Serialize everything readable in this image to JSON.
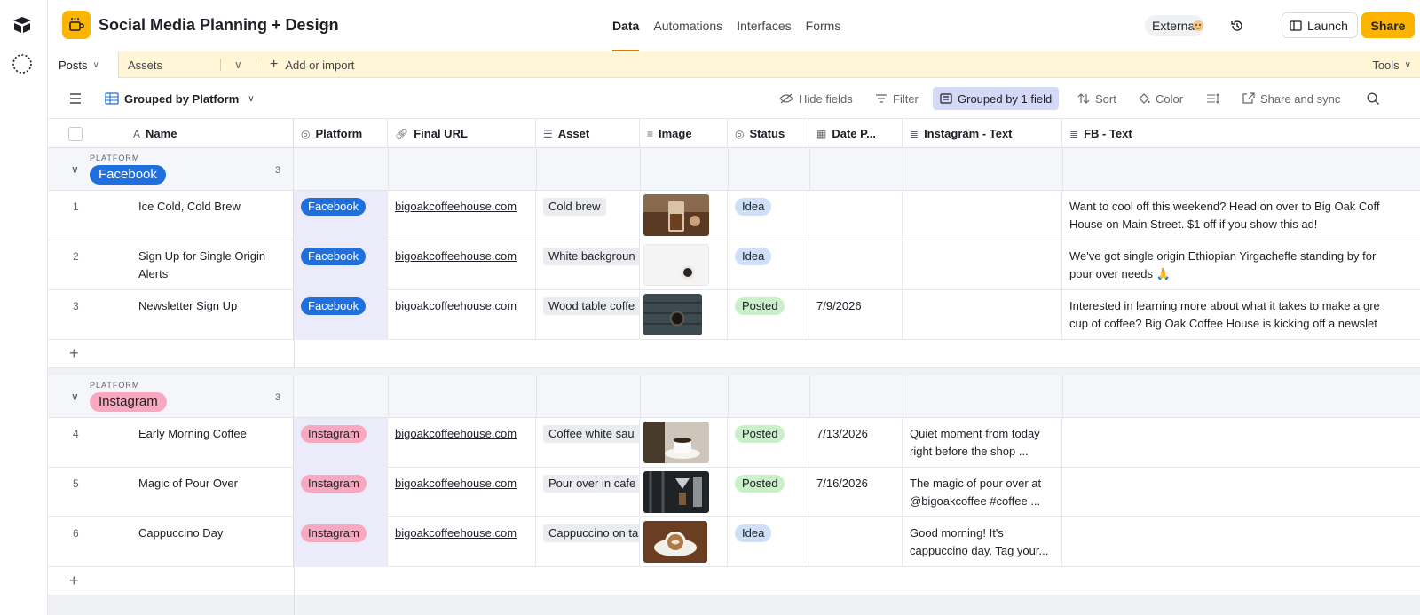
{
  "app": {
    "title": "Social Media Planning + Design",
    "nav": [
      "Data",
      "Automations",
      "Interfaces",
      "Forms"
    ],
    "active_nav": "Data",
    "external_label": "External",
    "launch_label": "Launch",
    "share_label": "Share",
    "accent_color": "#fcb400"
  },
  "tables": {
    "active": "Posts",
    "other": "Assets",
    "add_label": "Add or import",
    "tools_label": "Tools"
  },
  "view": {
    "name": "Grouped by Platform",
    "hide_fields": "Hide fields",
    "filter": "Filter",
    "grouped": "Grouped by 1 field",
    "sort": "Sort",
    "color": "Color",
    "share_sync": "Share and sync"
  },
  "columns": [
    "Name",
    "Platform",
    "Final URL",
    "Asset",
    "Image",
    "Status",
    "Date P...",
    "Instagram - Text",
    "FB - Text"
  ],
  "groups": [
    {
      "label": "PLATFORM",
      "value": "Facebook",
      "count": "3",
      "records": [
        {
          "num": "1",
          "name": "Ice Cold, Cold Brew",
          "platform": "Facebook",
          "url": "bigoakcoffeehouse.com",
          "asset": "Cold brew",
          "status": "Idea",
          "date": "",
          "ig_text": "",
          "fb_text_1": "Want to cool off this weekend? Head on over to Big Oak Coff",
          "fb_text_2": "House on Main Street. $1 off if you show this ad!"
        },
        {
          "num": "2",
          "name": "Sign Up for Single Origin Alerts",
          "platform": "Facebook",
          "url": "bigoakcoffeehouse.com",
          "asset": "White backgroun",
          "status": "Idea",
          "date": "",
          "ig_text": "",
          "fb_text_1": "We've got single origin Ethiopian Yirgacheffe standing by for",
          "fb_text_2": "pour over needs 🙏"
        },
        {
          "num": "3",
          "name": "Newsletter Sign Up",
          "platform": "Facebook",
          "url": "bigoakcoffeehouse.com",
          "asset": "Wood table coffe",
          "status": "Posted",
          "date": "7/9/2026",
          "ig_text": "",
          "fb_text_1": "Interested in learning more about what it takes to make a gre",
          "fb_text_2": "cup of coffee? Big Oak Coffee House is kicking off a newslet"
        }
      ]
    },
    {
      "label": "PLATFORM",
      "value": "Instagram",
      "count": "3",
      "records": [
        {
          "num": "4",
          "name": "Early Morning Coffee",
          "platform": "Instagram",
          "url": "bigoakcoffeehouse.com",
          "asset": "Coffee white sau",
          "status": "Posted",
          "date": "7/13/2026",
          "ig_text_1": "Quiet moment from today",
          "ig_text_2": "right before the shop ...",
          "fb_text_1": "",
          "fb_text_2": ""
        },
        {
          "num": "5",
          "name": "Magic of Pour Over",
          "platform": "Instagram",
          "url": "bigoakcoffeehouse.com",
          "asset": "Pour over in cafe",
          "status": "Posted",
          "date": "7/16/2026",
          "ig_text_1": "The magic of pour over at",
          "ig_text_2": "@bigoakcoffee #coffee ...",
          "fb_text_1": "",
          "fb_text_2": ""
        },
        {
          "num": "6",
          "name": "Cappuccino Day",
          "platform": "Instagram",
          "url": "bigoakcoffeehouse.com",
          "asset": "Cappuccino on ta",
          "status": "Idea",
          "date": "",
          "ig_text_1": "Good morning! It's",
          "ig_text_2": "cappuccino day. Tag your...",
          "fb_text_1": "",
          "fb_text_2": ""
        }
      ]
    }
  ]
}
